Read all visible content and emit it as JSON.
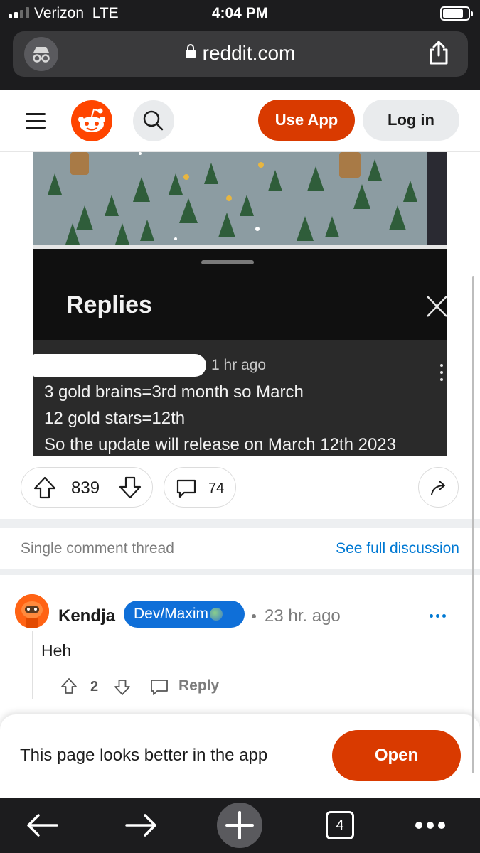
{
  "status_bar": {
    "carrier": "Verizon",
    "network": "LTE",
    "time": "4:04 PM"
  },
  "browser": {
    "url": "reddit.com",
    "tab_count": "4"
  },
  "header": {
    "use_app_label": "Use App",
    "login_label": "Log in"
  },
  "post_image": {
    "sheet_title": "Replies",
    "comment_time": "1 hr ago",
    "comment_lines": [
      "3 gold brains=3rd month so March",
      "12 gold stars=12th",
      "So the update will release on March 12th 2023"
    ]
  },
  "post_actions": {
    "score": "839",
    "comment_count": "74"
  },
  "thread_bar": {
    "single_label": "Single comment thread",
    "see_full_label": "See full discussion"
  },
  "comment": {
    "author": "Kendja",
    "flair": "Dev/Maxim",
    "time": "23 hr. ago",
    "body": "Heh",
    "score": "2",
    "reply_label": "Reply"
  },
  "app_banner": {
    "text": "This page looks better in the app",
    "open_label": "Open"
  },
  "colors": {
    "reddit_orange": "#ff4500",
    "button_orange": "#d93a00",
    "link_blue": "#0079d3",
    "flair_blue": "#0f6fd8"
  },
  "icons": [
    "incognito-icon",
    "lock-icon",
    "share-icon",
    "menu-icon",
    "reddit-logo",
    "search-icon",
    "close-icon",
    "more-vertical-icon",
    "upvote-icon",
    "downvote-icon",
    "comment-icon",
    "share-arrow-icon",
    "more-horizontal-icon",
    "back-icon",
    "forward-icon",
    "new-tab-icon",
    "tabs-icon",
    "more-icon"
  ]
}
